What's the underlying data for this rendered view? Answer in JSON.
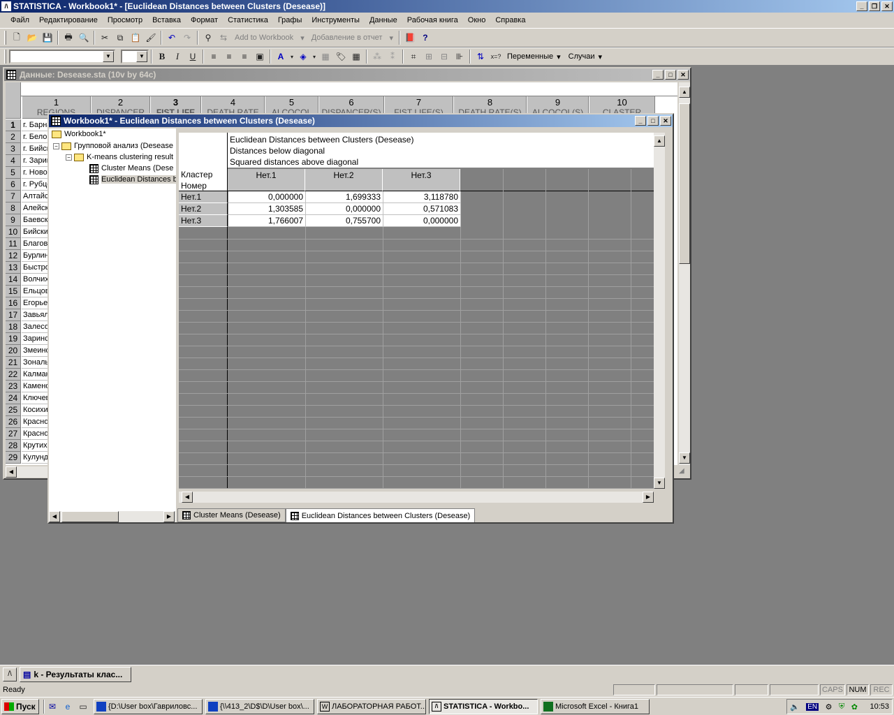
{
  "app": {
    "title": "STATISTICA - Workbook1* - [Euclidean Distances between Clusters (Desease)]",
    "icon_glyph": "/\\"
  },
  "menu": [
    "Файл",
    "Редактирование",
    "Просмотр",
    "Вставка",
    "Формат",
    "Статистика",
    "Графы",
    "Инструменты",
    "Данные",
    "Рабочая книга",
    "Окно",
    "Справка"
  ],
  "toolbar1": {
    "add_to_workbook": "Add to Workbook",
    "add_to_report": "Добавление в отчет"
  },
  "toolbar2": {
    "bold": "B",
    "italic": "I",
    "underline": "U",
    "variables": "Переменные",
    "cases": "Случаи"
  },
  "data_window": {
    "title": "Данные: Desease.sta (10v by 64c)",
    "columns": [
      {
        "num": "1",
        "name": "REGIONS"
      },
      {
        "num": "2",
        "name": "DISPANCER"
      },
      {
        "num": "3",
        "name": "FIST LIFE"
      },
      {
        "num": "4",
        "name": "DEATH RATE"
      },
      {
        "num": "5",
        "name": "ALCOCOL"
      },
      {
        "num": "6",
        "name": "DISPANCER(S)"
      },
      {
        "num": "7",
        "name": "FIST LIFE(S)"
      },
      {
        "num": "8",
        "name": "DEATH RATE(S)"
      },
      {
        "num": "9",
        "name": "ALCOCOL(S)"
      },
      {
        "num": "10",
        "name": "CLASTER"
      }
    ],
    "rows": [
      {
        "n": "1",
        "name": "г. Барна"
      },
      {
        "n": "2",
        "name": "г. Белок"
      },
      {
        "n": "3",
        "name": "г. Бийск"
      },
      {
        "n": "4",
        "name": "г. Зарин"
      },
      {
        "n": "5",
        "name": "г. Новоа"
      },
      {
        "n": "6",
        "name": "г. Рубцо"
      },
      {
        "n": "7",
        "name": "Алтайск"
      },
      {
        "n": "8",
        "name": "Алейски"
      },
      {
        "n": "9",
        "name": "Баевски"
      },
      {
        "n": "10",
        "name": "Бийский"
      },
      {
        "n": "11",
        "name": "Благове"
      },
      {
        "n": "12",
        "name": "Бурлин"
      },
      {
        "n": "13",
        "name": "Быстро"
      },
      {
        "n": "14",
        "name": "Волчих"
      },
      {
        "n": "15",
        "name": "Ельцов"
      },
      {
        "n": "16",
        "name": "Егорьев"
      },
      {
        "n": "17",
        "name": "Завьял"
      },
      {
        "n": "18",
        "name": "Залесо"
      },
      {
        "n": "19",
        "name": "Заринс"
      },
      {
        "n": "20",
        "name": "Змеино"
      },
      {
        "n": "21",
        "name": "Зональ"
      },
      {
        "n": "22",
        "name": "Калман"
      },
      {
        "n": "23",
        "name": "Камено"
      },
      {
        "n": "24",
        "name": "Ключев"
      },
      {
        "n": "25",
        "name": "Косихи"
      },
      {
        "n": "26",
        "name": "Красно"
      },
      {
        "n": "27",
        "name": "Красно"
      },
      {
        "n": "28",
        "name": "Крутих"
      },
      {
        "n": "29",
        "name": "Кулунд"
      }
    ]
  },
  "workbook": {
    "title": "Workbook1* - Euclidean Distances between Clusters (Desease)",
    "tree": {
      "root": "Workbook1*",
      "group": "Групповой анализ (Desease",
      "kmeans": "K-means clustering result",
      "item1": "Cluster Means (Dese",
      "item2": "Euclidean Distances b"
    },
    "sheet": {
      "title_lines": [
        "Euclidean Distances between Clusters (Desease)",
        "Distances below diagonal",
        "Squared distances above diagonal"
      ],
      "corner_label": [
        "Кластер",
        "Номер"
      ],
      "columns": [
        "Нет.1",
        "Нет.2",
        "Нет.3"
      ],
      "rows": [
        {
          "label": "Нет.1",
          "values": [
            "0,000000",
            "1,699333",
            "3,118780"
          ]
        },
        {
          "label": "Нет.2",
          "values": [
            "1,303585",
            "0,000000",
            "0,571083"
          ]
        },
        {
          "label": "Нет.3",
          "values": [
            "1,766007",
            "0,755700",
            "0,000000"
          ]
        }
      ]
    },
    "tabs": [
      "Cluster Means (Desease)",
      "Euclidean Distances between Clusters (Desease)"
    ]
  },
  "minimized": {
    "label": "k - Результаты клас..."
  },
  "status": {
    "text": "Ready",
    "caps": "CAPS",
    "num": "NUM",
    "rec": "REC"
  },
  "taskbar": {
    "start": "Пуск",
    "tasks": [
      "{D:\\User box\\Гавриловс...",
      "{\\\\413_2\\D$\\D\\User box\\...",
      "ЛАБОРАТОРНАЯ РАБОТ...",
      "STATISTICA - Workbo...",
      "Microsoft Excel - Книга1"
    ],
    "lang": "EN",
    "clock": "10:53"
  }
}
